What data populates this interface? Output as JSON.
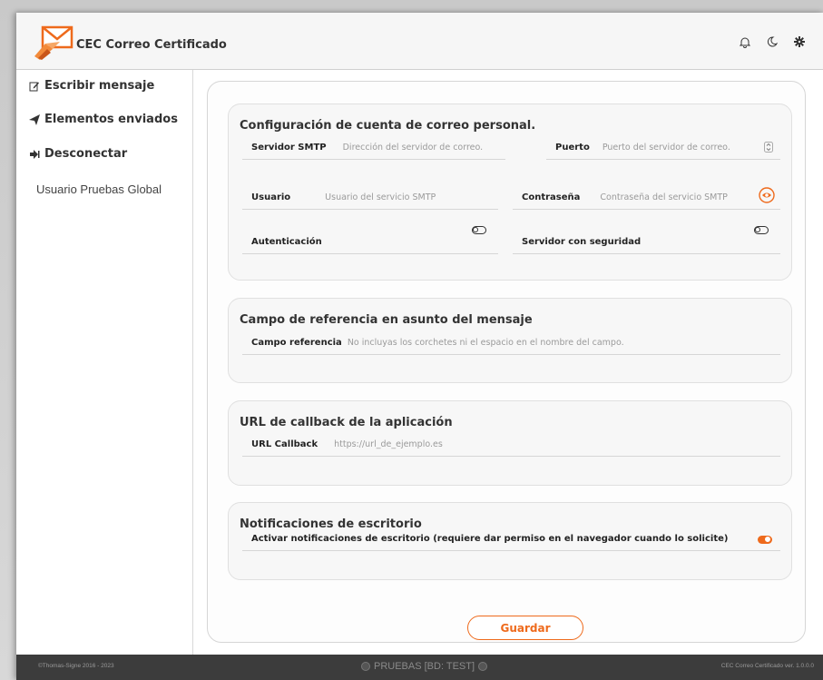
{
  "header": {
    "app_title": "CEC Correo Certificado",
    "icons": [
      "bell-icon",
      "moon-icon",
      "gear-icon"
    ]
  },
  "sidebar": {
    "items": [
      {
        "label": "Escribir mensaje",
        "icon": "edit-icon"
      },
      {
        "label": "Elementos enviados",
        "icon": "send-icon"
      },
      {
        "label": "Desconectar",
        "icon": "logout-icon"
      }
    ],
    "user": "Usuario Pruebas Global"
  },
  "smtp": {
    "title": "Configuración de cuenta de correo personal.",
    "server_label": "Servidor SMTP",
    "server_placeholder": "Dirección del servidor de correo.",
    "port_label": "Puerto",
    "port_placeholder": "Puerto del servidor de correo.",
    "user_label": "Usuario",
    "user_placeholder": "Usuario del servicio SMTP",
    "password_label": "Contraseña",
    "password_placeholder": "Contraseña del servicio SMTP",
    "auth_label": "Autenticación",
    "auth_on": false,
    "secure_label": "Servidor con seguridad",
    "secure_on": false
  },
  "reference": {
    "title": "Campo de referencia en asunto del mensaje",
    "field_label": "Campo referencia",
    "field_placeholder": "No incluyas los corchetes ni el espacio en el nombre del campo."
  },
  "callback": {
    "title": "URL de callback de la aplicación",
    "field_label": "URL Callback",
    "field_placeholder": "https://url_de_ejemplo.es"
  },
  "notifications": {
    "title": "Notificaciones de escritorio",
    "label": "Activar notificaciones de escritorio (requiere dar permiso en el navegador cuando lo solicite)",
    "enabled": true
  },
  "actions": {
    "save_label": "Guardar"
  },
  "footer": {
    "left": "©Thomas-Signe 2016 - 2023",
    "center": "PRUEBAS [BD: TEST]",
    "right": "CEC Correo Certificado ver. 1.0.0.0"
  },
  "colors": {
    "accent": "#ee6a1c",
    "footer_bg": "#3c3c3c"
  }
}
